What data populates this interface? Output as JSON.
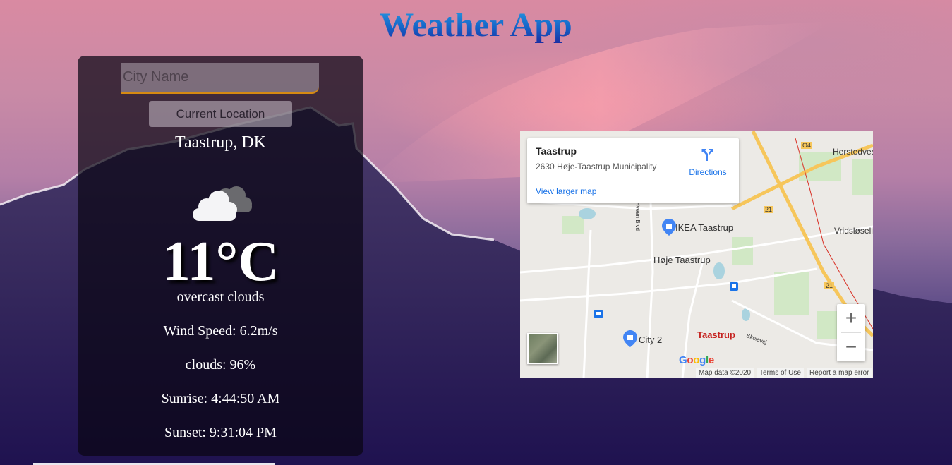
{
  "app": {
    "title": "Weather App"
  },
  "search": {
    "placeholder": "City Name",
    "value": ""
  },
  "location_button": {
    "label": "Current Location"
  },
  "weather": {
    "location": "Taastrup, DK",
    "icon": "overcast-clouds-icon",
    "temperature": "11°C",
    "description": "overcast clouds",
    "wind": "Wind Speed: 6.2m/s",
    "clouds": "clouds: 96%",
    "sunrise": "Sunrise: 4:44:50 AM",
    "sunset": "Sunset: 9:31:04 PM"
  },
  "map": {
    "info": {
      "title": "Taastrup",
      "address": "2630 Høje-Taastrup Municipality",
      "directions": "Directions",
      "larger_map": "View larger map"
    },
    "labels": {
      "ikea": "IKEA Taastrup",
      "hoje": "Høje Taastrup",
      "city2": "City 2",
      "taastrup": "Taastrup",
      "herstedvester": "Herstedves",
      "vridsloselille": "Vridsløseli",
      "hveen": "Hveen Blvd",
      "skolevej": "Skolevej",
      "road_o4": "O4",
      "road_21a": "21",
      "road_21b": "21"
    },
    "zoom_in": "+",
    "zoom_out": "−",
    "logo": "Google",
    "attribution": {
      "map_data": "Map data ©2020",
      "terms": "Terms of Use",
      "report": "Report a map error"
    }
  },
  "colors": {
    "title_gradient": [
      "#2aa0e6",
      "#1a2aa0"
    ],
    "input_underline": "#d68a12",
    "map_link": "#1a73e8",
    "map_marker": "#c5221f"
  }
}
